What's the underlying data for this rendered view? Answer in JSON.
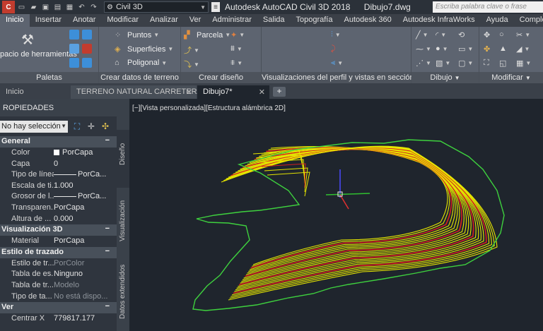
{
  "workspace": "Civil 3D",
  "title": {
    "app": "Autodesk AutoCAD Civil 3D 2018",
    "file": "Dibujo7.dwg"
  },
  "search": {
    "placeholder": "Escriba palabra clave o frase"
  },
  "ribbon_tabs": [
    "Inicio",
    "Insertar",
    "Anotar",
    "Modificar",
    "Analizar",
    "Ver",
    "Administrar",
    "Salida",
    "Topografía",
    "Autodesk 360",
    "Autodesk InfraWorks",
    "Ayuda",
    "Complementos"
  ],
  "panels": {
    "paletas": {
      "title": "Paletas",
      "tool": "pacio de herramientas"
    },
    "crear_datos": {
      "title": "Crear datos de terreno",
      "puntos": "Puntos",
      "superficies": "Superficies",
      "poligonal": "Poligonal"
    },
    "crear_diseno": {
      "title": "Crear diseño",
      "parcela": "Parcela"
    },
    "perfil": {
      "title": "Visualizaciones del perfil y vistas en sección"
    },
    "dibujo": {
      "title": "Dibujo"
    },
    "modificar": {
      "title": "Modificar"
    }
  },
  "file_tabs": [
    "Inicio",
    "TERRENO NATURAL CARRETERA*",
    "Dibujo7*"
  ],
  "properties": {
    "title": "ROPIEDADES",
    "selection": "No hay selección",
    "sections": {
      "general": "General",
      "vis3d": "Visualización 3D",
      "estilo": "Estilo de trazado",
      "ver": "Ver"
    },
    "toggle": "−",
    "general_rows": [
      {
        "name": "Color",
        "value": "PorCapa"
      },
      {
        "name": "Capa",
        "value": "0"
      },
      {
        "name": "Tipo de línea",
        "value": "PorCa..."
      },
      {
        "name": "Escala de ti...",
        "value": "1.000"
      },
      {
        "name": "Grosor de l...",
        "value": "PorCa..."
      },
      {
        "name": "Transparen...",
        "value": "PorCapa"
      },
      {
        "name": "Altura de ...",
        "value": "0.000"
      }
    ],
    "vis3d_rows": [
      {
        "name": "Material",
        "value": "PorCapa"
      }
    ],
    "estilo_rows": [
      {
        "name": "Estilo de tr...",
        "value": "PorColor"
      },
      {
        "name": "Tabla de es...",
        "value": "Ninguno"
      },
      {
        "name": "Tabla de tr...",
        "value": "Modelo"
      },
      {
        "name": "Tipo de ta...",
        "value": "No está dispo..."
      }
    ],
    "ver_rows": [
      {
        "name": "Centrar X",
        "value": "779817.177"
      }
    ]
  },
  "side_tabs": [
    "Diseño",
    "Visualización",
    "Datos extendidos"
  ],
  "viewport_label": "[−][Vista personalizada][Estructura alámbrica 2D]",
  "colors": {
    "boundary": "#3ed13e",
    "contour_minor": "#e6e600",
    "contour_major": "#d42020",
    "ucs_y": "#4a4aff",
    "ucs_x": "#e03030",
    "ucs_z": "#30c030"
  }
}
